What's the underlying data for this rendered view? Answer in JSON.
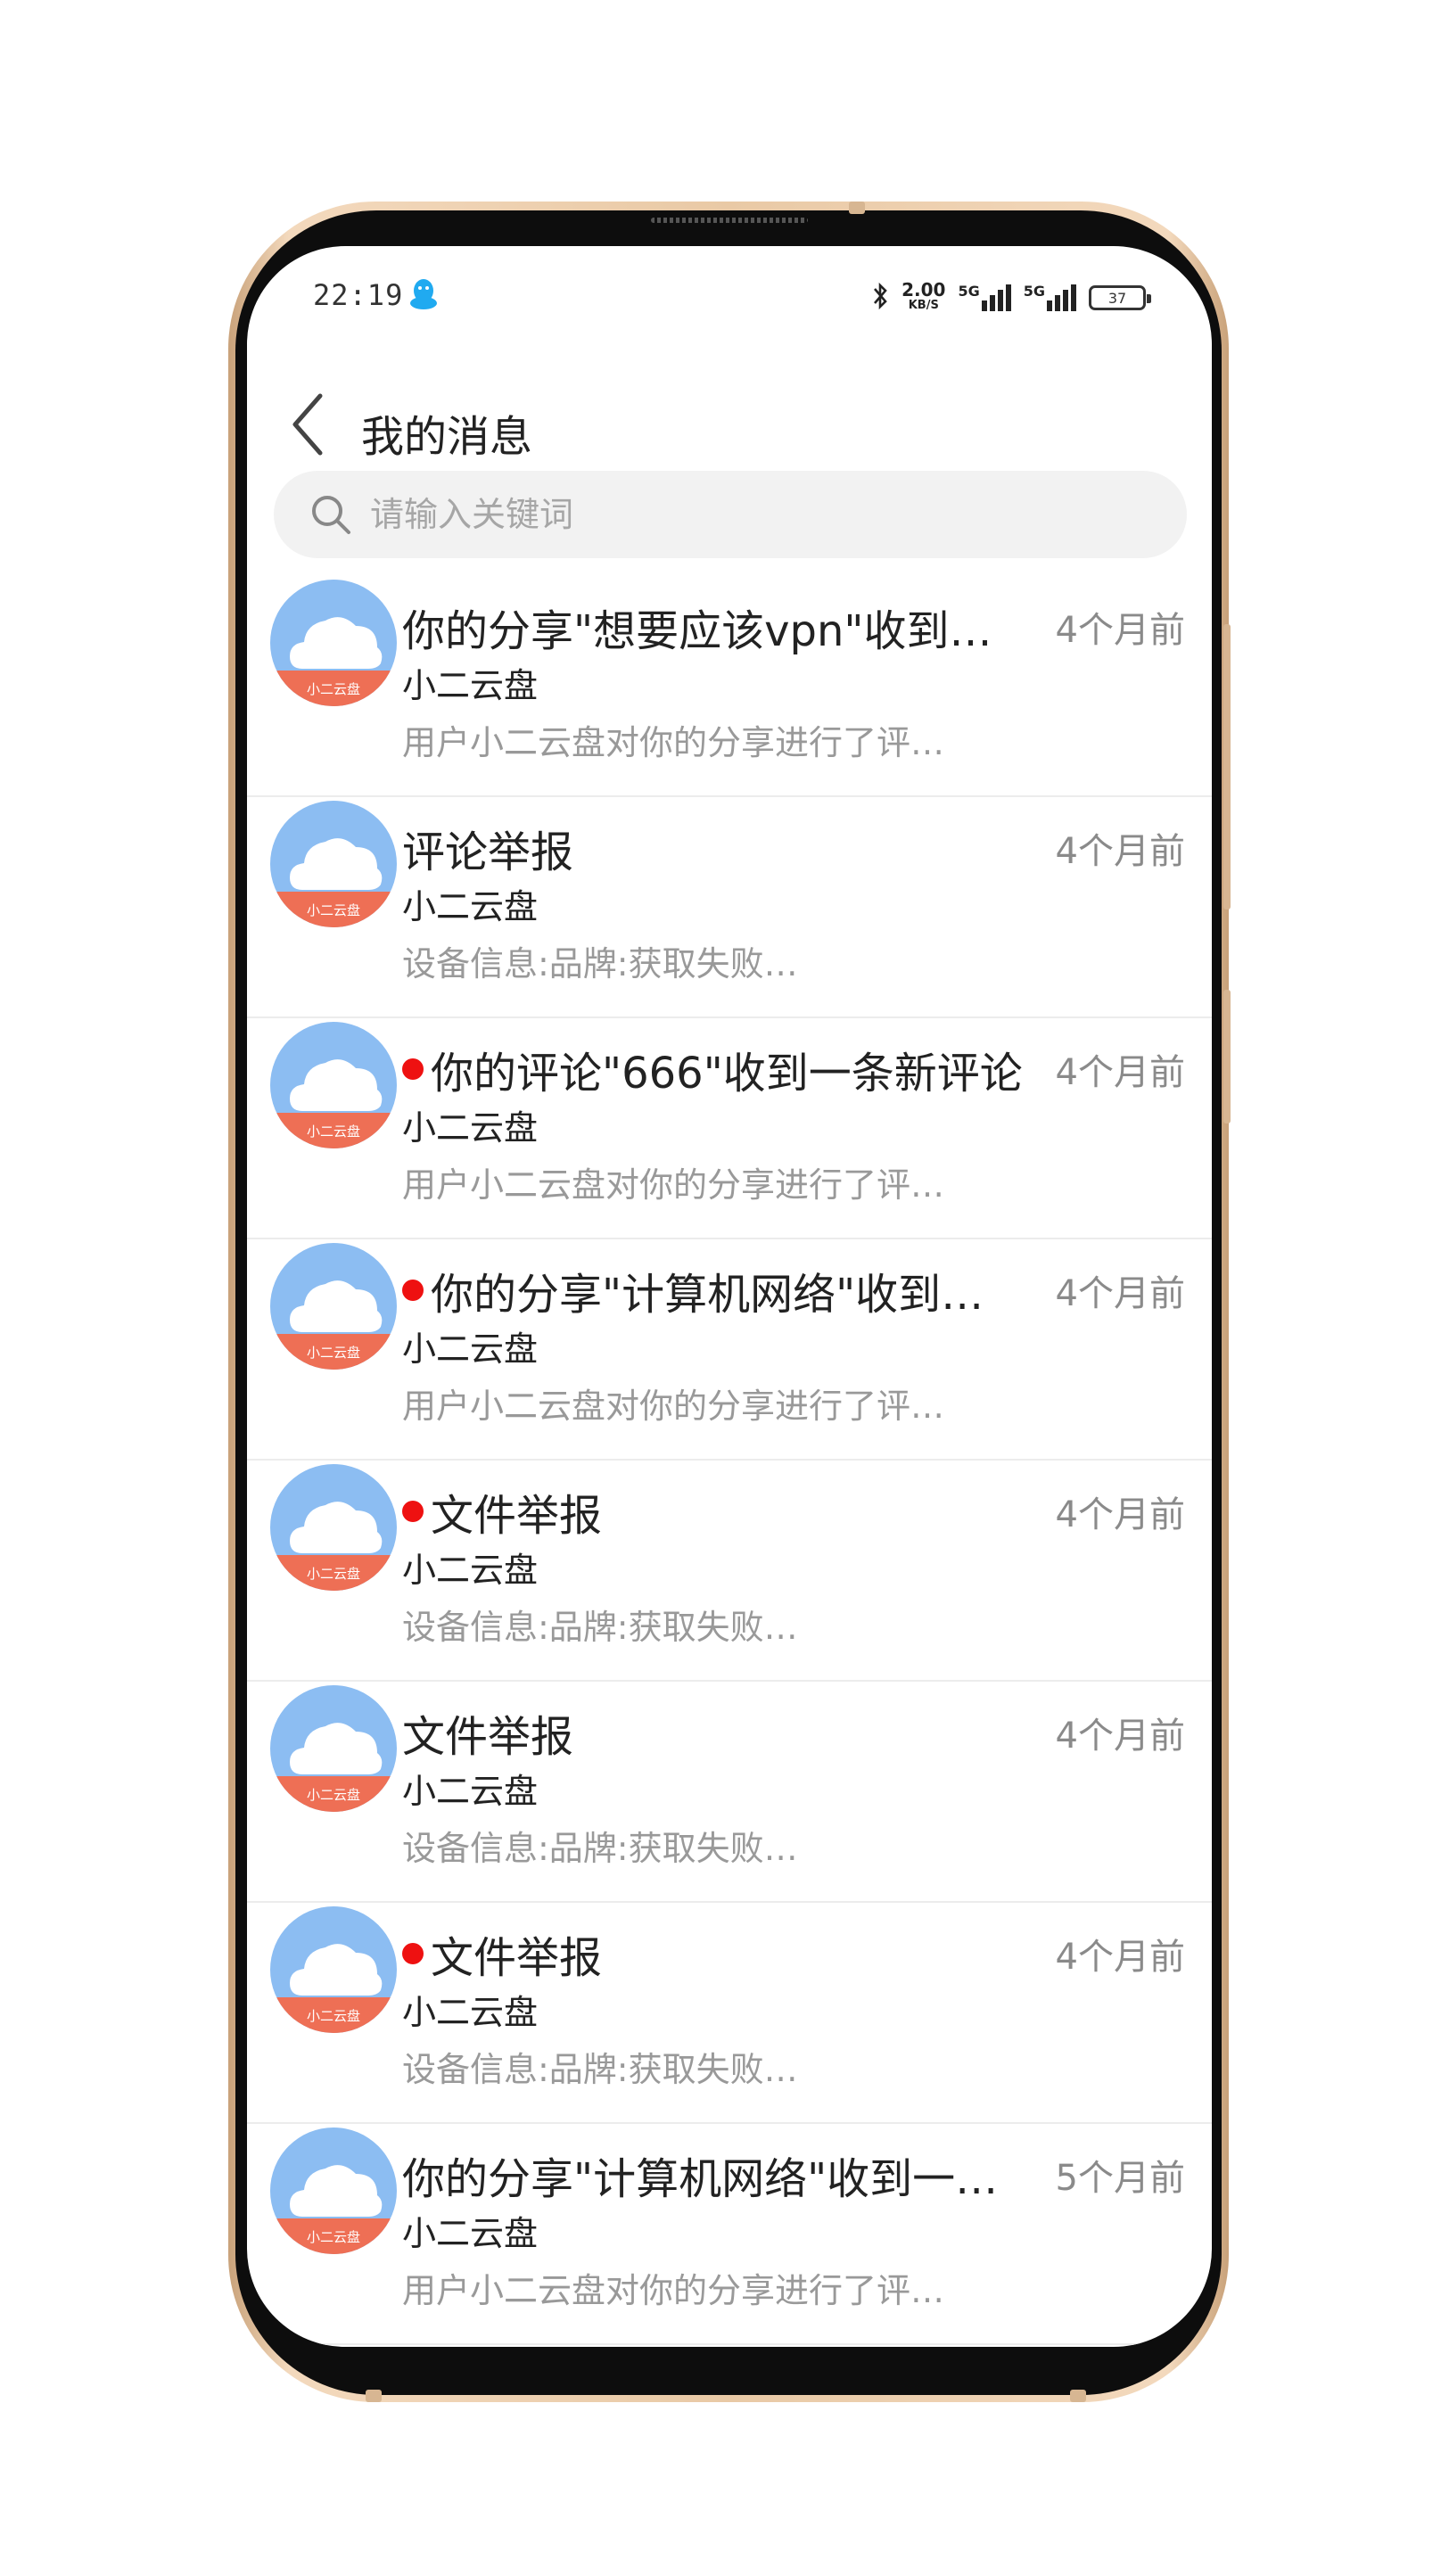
{
  "status_bar": {
    "time": "22:19",
    "speed_value": "2.00",
    "speed_unit": "KB/S",
    "network1": "5G",
    "network2": "5G",
    "battery": "37"
  },
  "header": {
    "title": "我的消息"
  },
  "search": {
    "placeholder": "请输入关键词"
  },
  "messages": [
    {
      "title": "你的分享\"想要应该vpn\"收到…",
      "sender": "小二云盘",
      "preview": "用户小二云盘对你的分享进行了评…",
      "time": "4个月前",
      "unread": false
    },
    {
      "title": "评论举报",
      "sender": "小二云盘",
      "preview": "设备信息:品牌:获取失败…",
      "time": "4个月前",
      "unread": false
    },
    {
      "title": "你的评论\"666\"收到一条新评论",
      "sender": "小二云盘",
      "preview": "用户小二云盘对你的分享进行了评…",
      "time": "4个月前",
      "unread": true
    },
    {
      "title": "你的分享\"计算机网络\"收到…",
      "sender": "小二云盘",
      "preview": "用户小二云盘对你的分享进行了评…",
      "time": "4个月前",
      "unread": true
    },
    {
      "title": "文件举报",
      "sender": "小二云盘",
      "preview": "设备信息:品牌:获取失败…",
      "time": "4个月前",
      "unread": true
    },
    {
      "title": "文件举报",
      "sender": "小二云盘",
      "preview": "设备信息:品牌:获取失败…",
      "time": "4个月前",
      "unread": false
    },
    {
      "title": "文件举报",
      "sender": "小二云盘",
      "preview": "设备信息:品牌:获取失败…",
      "time": "4个月前",
      "unread": true
    },
    {
      "title": "你的分享\"计算机网络\"收到一…",
      "sender": "小二云盘",
      "preview": "用户小二云盘对你的分享进行了评…",
      "time": "5个月前",
      "unread": false
    }
  ],
  "avatar_label": "小二云盘",
  "colors": {
    "avatar_sky": "#8cbdf2",
    "avatar_band": "#ee6f55",
    "unread_dot": "#ee1111",
    "frame_gold": "#e9c9a5"
  }
}
